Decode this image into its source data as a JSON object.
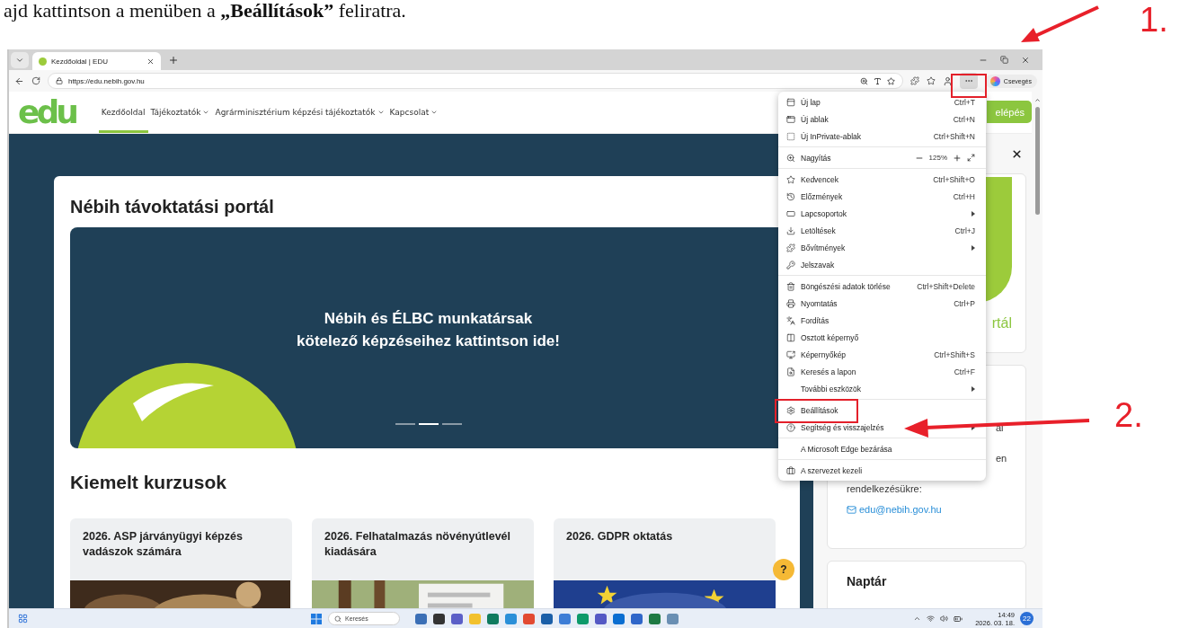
{
  "instruction": "ajd kattintson a menüben a **„Beállítások”** feliratra.",
  "annotations": [
    {
      "label": "1."
    },
    {
      "label": "2."
    }
  ],
  "browser": {
    "tabs": [
      {
        "title": "Kezdőoldal | EDU",
        "selected": true
      }
    ],
    "url": "https://edu.nebih.gov.hu",
    "chat_button": "Csevegés",
    "more_pressed": true
  },
  "site": {
    "logo": "edu",
    "nav": [
      {
        "label": "Kezdőoldal",
        "selected": true,
        "dropdown": false
      },
      {
        "label": "Tájékoztatók",
        "selected": false,
        "dropdown": true
      },
      {
        "label": "Agrárminisztérium képzési tájékoztatók",
        "selected": false,
        "dropdown": true
      },
      {
        "label": "Kapcsolat",
        "selected": false,
        "dropdown": true
      }
    ],
    "login_button": "elépés"
  },
  "main": {
    "title": "Nébih távoktatási portál",
    "hero": {
      "text": "Nébih és ÉLBC munkatársak\nkötelező képzéseihez kattintson ide!",
      "slides": [
        {
          "selected": false
        },
        {
          "selected": true
        },
        {
          "selected": false
        }
      ]
    },
    "featured_title": "Kiemelt kurzusok",
    "courses": [
      {
        "title": "2026. ASP járványügyi képzés vadászok számára"
      },
      {
        "title": "2026. Felhatalmazás növényútlevél kiadására"
      },
      {
        "title": "2026. GDPR oktatás"
      }
    ],
    "help_button": "?"
  },
  "sidebar": {
    "cards": [
      {
        "caption": "rtál"
      },
      {
        "kind": "contact",
        "partial_lines": [
          "al",
          "en"
        ],
        "lines": [
          "rendelkezésükre:"
        ],
        "email": "edu@nebih.gov.hu"
      },
      {
        "kind": "title",
        "title": "Naptár"
      }
    ]
  },
  "menu": {
    "groups": [
      [
        {
          "kind": "item",
          "label": "Új lap",
          "shortcut": "Ctrl+T",
          "submenu": false
        },
        {
          "kind": "item",
          "label": "Új ablak",
          "shortcut": "Ctrl+N",
          "submenu": false
        },
        {
          "kind": "item",
          "label": "Új InPrivate-ablak",
          "shortcut": "Ctrl+Shift+N",
          "submenu": false
        }
      ],
      [
        {
          "kind": "zoom",
          "label": "Nagyítás",
          "value": "125%"
        }
      ],
      [
        {
          "kind": "item",
          "label": "Kedvencek",
          "shortcut": "Ctrl+Shift+O",
          "submenu": false
        },
        {
          "kind": "item",
          "label": "Előzmények",
          "shortcut": "Ctrl+H",
          "submenu": false
        },
        {
          "kind": "item",
          "label": "Lapcsoportok",
          "submenu": true
        },
        {
          "kind": "item",
          "label": "Letöltések",
          "shortcut": "Ctrl+J",
          "submenu": false
        },
        {
          "kind": "item",
          "label": "Bővítmények",
          "submenu": true
        },
        {
          "kind": "item",
          "label": "Jelszavak",
          "submenu": false
        }
      ],
      [
        {
          "kind": "item",
          "label": "Böngészési adatok törlése",
          "shortcut": "Ctrl+Shift+Delete",
          "submenu": false
        },
        {
          "kind": "item",
          "label": "Nyomtatás",
          "shortcut": "Ctrl+P",
          "submenu": false
        },
        {
          "kind": "item",
          "label": "Fordítás",
          "submenu": false
        },
        {
          "kind": "item",
          "label": "Osztott képernyő",
          "submenu": false
        },
        {
          "kind": "item",
          "label": "Képernyőkép",
          "shortcut": "Ctrl+Shift+S",
          "submenu": false
        },
        {
          "kind": "item",
          "label": "Keresés a lapon",
          "shortcut": "Ctrl+F",
          "submenu": false
        },
        {
          "kind": "item",
          "label": "További eszközök",
          "submenu": true
        }
      ],
      [
        {
          "kind": "item",
          "label": "Beállítások",
          "submenu": false
        },
        {
          "kind": "item",
          "label": "Segítség és visszajelzés",
          "submenu": true
        }
      ],
      [
        {
          "kind": "item",
          "label": "A Microsoft Edge bezárása",
          "submenu": false
        }
      ],
      [
        {
          "kind": "item",
          "label": "A szervezet kezeli",
          "submenu": false
        }
      ]
    ]
  },
  "taskbar": {
    "search": "Keresés",
    "time": "14:49",
    "date": "2026. 03. 18.",
    "badge": "22"
  }
}
